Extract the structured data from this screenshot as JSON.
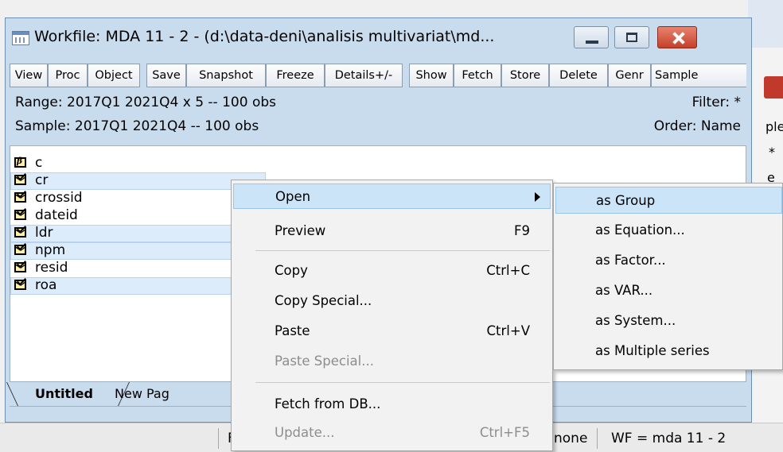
{
  "window": {
    "title": "Workfile: MDA 11 - 2 - (d:\\data-deni\\analisis multivariat\\md..."
  },
  "toolbar": {
    "buttons": [
      "View",
      "Proc",
      "Object",
      "Save",
      "Snapshot",
      "Freeze",
      "Details+/-",
      "Show",
      "Fetch",
      "Store",
      "Delete",
      "Genr",
      "Sample"
    ]
  },
  "info": {
    "range": "Range:  2017Q1 2021Q4 x 5  --  100 obs",
    "sample": "Sample: 2017Q1 2021Q4  --  100 obs",
    "filter": "Filter: *",
    "order": "Order: Name"
  },
  "objects": [
    {
      "name": "c",
      "kind": "coef",
      "selected": false
    },
    {
      "name": "cr",
      "kind": "series",
      "selected": true
    },
    {
      "name": "crossid",
      "kind": "series",
      "selected": false
    },
    {
      "name": "dateid",
      "kind": "series",
      "selected": false
    },
    {
      "name": "ldr",
      "kind": "series",
      "selected": true
    },
    {
      "name": "npm",
      "kind": "series",
      "selected": true
    },
    {
      "name": "resid",
      "kind": "series",
      "selected": false
    },
    {
      "name": "roa",
      "kind": "series",
      "selected": true
    }
  ],
  "tabs": {
    "active": "Untitled",
    "new_page": "New Pag"
  },
  "context_menu": {
    "items": [
      {
        "label": "Open",
        "shortcut": "",
        "submenu": true,
        "state": "active"
      },
      {
        "label": "Preview",
        "shortcut": "F9",
        "state": "normal"
      },
      {
        "label": "Copy",
        "shortcut": "Ctrl+C",
        "state": "normal"
      },
      {
        "label": "Copy Special...",
        "shortcut": "",
        "state": "normal"
      },
      {
        "label": "Paste",
        "shortcut": "Ctrl+V",
        "state": "normal"
      },
      {
        "label": "Paste Special...",
        "shortcut": "",
        "state": "disabled"
      },
      {
        "label": "Fetch from DB...",
        "shortcut": "",
        "state": "normal"
      },
      {
        "label": "Update...",
        "shortcut": "Ctrl+F5",
        "state": "disabled"
      }
    ]
  },
  "open_submenu": {
    "items": [
      "as Group",
      "as Equation...",
      "as Factor...",
      "as VAR...",
      "as System...",
      "as Multiple series"
    ]
  },
  "statusbar": {
    "left_fragment": "F",
    "db": "none",
    "wf": "WF = mda 11 - 2"
  },
  "background": {
    "fragment1": "ple",
    "fragment2": "*",
    "fragment3": "e"
  }
}
